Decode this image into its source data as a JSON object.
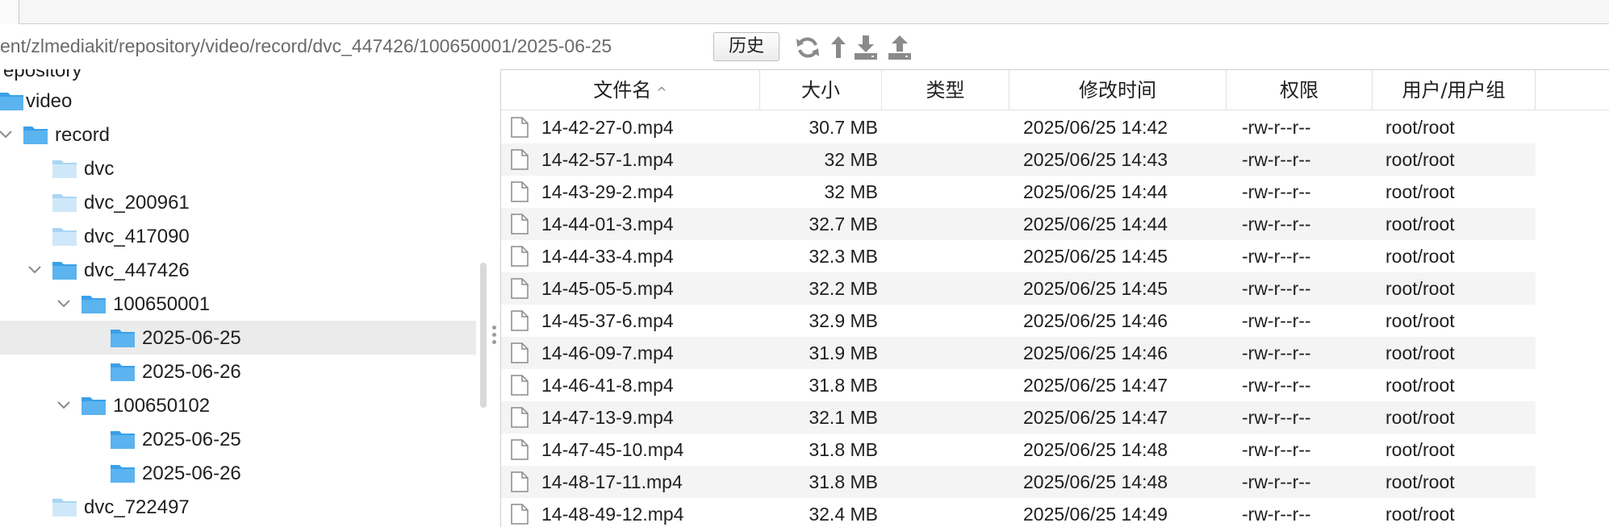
{
  "path_bar": {
    "path": "ent/zlmediakit/repository/video/record/dvc_447426/100650001/2025-06-25",
    "history_button": "历史"
  },
  "toolbar_icons": [
    "refresh-icon",
    "go-up-icon",
    "download-icon",
    "upload-icon"
  ],
  "tree": {
    "partial_top_label": "epository",
    "items": [
      {
        "label": "video",
        "expanded": false,
        "selected": false
      },
      {
        "label": "record",
        "expanded": true,
        "selected": false
      },
      {
        "label": "dvc",
        "expanded": false,
        "selected": false
      },
      {
        "label": "dvc_200961",
        "expanded": false,
        "selected": false
      },
      {
        "label": "dvc_417090",
        "expanded": false,
        "selected": false
      },
      {
        "label": "dvc_447426",
        "expanded": true,
        "selected": false
      },
      {
        "label": "100650001",
        "expanded": true,
        "selected": false
      },
      {
        "label": "2025-06-25",
        "expanded": false,
        "selected": true
      },
      {
        "label": "2025-06-26",
        "expanded": false,
        "selected": false
      },
      {
        "label": "100650102",
        "expanded": true,
        "selected": false
      },
      {
        "label": "2025-06-25",
        "expanded": false,
        "selected": false
      },
      {
        "label": "2025-06-26",
        "expanded": false,
        "selected": false
      },
      {
        "label": "dvc_722497",
        "expanded": false,
        "selected": false
      }
    ]
  },
  "file_table": {
    "headers": {
      "name": "文件名",
      "size": "大小",
      "type": "类型",
      "modified": "修改时间",
      "permissions": "权限",
      "owner": "用户/用户组"
    },
    "sort_indicator": "^",
    "rows": [
      {
        "name": "14-42-27-0.mp4",
        "size": "30.7 MB",
        "type": "",
        "modified": "2025/06/25 14:42",
        "permissions": "-rw-r--r--",
        "owner": "root/root"
      },
      {
        "name": "14-42-57-1.mp4",
        "size": "32 MB",
        "type": "",
        "modified": "2025/06/25 14:43",
        "permissions": "-rw-r--r--",
        "owner": "root/root"
      },
      {
        "name": "14-43-29-2.mp4",
        "size": "32 MB",
        "type": "",
        "modified": "2025/06/25 14:44",
        "permissions": "-rw-r--r--",
        "owner": "root/root"
      },
      {
        "name": "14-44-01-3.mp4",
        "size": "32.7 MB",
        "type": "",
        "modified": "2025/06/25 14:44",
        "permissions": "-rw-r--r--",
        "owner": "root/root"
      },
      {
        "name": "14-44-33-4.mp4",
        "size": "32.3 MB",
        "type": "",
        "modified": "2025/06/25 14:45",
        "permissions": "-rw-r--r--",
        "owner": "root/root"
      },
      {
        "name": "14-45-05-5.mp4",
        "size": "32.2 MB",
        "type": "",
        "modified": "2025/06/25 14:45",
        "permissions": "-rw-r--r--",
        "owner": "root/root"
      },
      {
        "name": "14-45-37-6.mp4",
        "size": "32.9 MB",
        "type": "",
        "modified": "2025/06/25 14:46",
        "permissions": "-rw-r--r--",
        "owner": "root/root"
      },
      {
        "name": "14-46-09-7.mp4",
        "size": "31.9 MB",
        "type": "",
        "modified": "2025/06/25 14:46",
        "permissions": "-rw-r--r--",
        "owner": "root/root"
      },
      {
        "name": "14-46-41-8.mp4",
        "size": "31.8 MB",
        "type": "",
        "modified": "2025/06/25 14:47",
        "permissions": "-rw-r--r--",
        "owner": "root/root"
      },
      {
        "name": "14-47-13-9.mp4",
        "size": "32.1 MB",
        "type": "",
        "modified": "2025/06/25 14:47",
        "permissions": "-rw-r--r--",
        "owner": "root/root"
      },
      {
        "name": "14-47-45-10.mp4",
        "size": "31.8 MB",
        "type": "",
        "modified": "2025/06/25 14:48",
        "permissions": "-rw-r--r--",
        "owner": "root/root"
      },
      {
        "name": "14-48-17-11.mp4",
        "size": "31.8 MB",
        "type": "",
        "modified": "2025/06/25 14:48",
        "permissions": "-rw-r--r--",
        "owner": "root/root"
      },
      {
        "name": "14-48-49-12.mp4",
        "size": "32.4 MB",
        "type": "",
        "modified": "2025/06/25 14:49",
        "permissions": "-rw-r--r--",
        "owner": "root/root"
      }
    ]
  },
  "colors": {
    "folder": "#3aa0e8",
    "folder_light": "#bfe0f7",
    "selected_row": "#ebebeb",
    "alt_row": "#f4f4f4",
    "icon_gray": "#8a8a8a"
  }
}
